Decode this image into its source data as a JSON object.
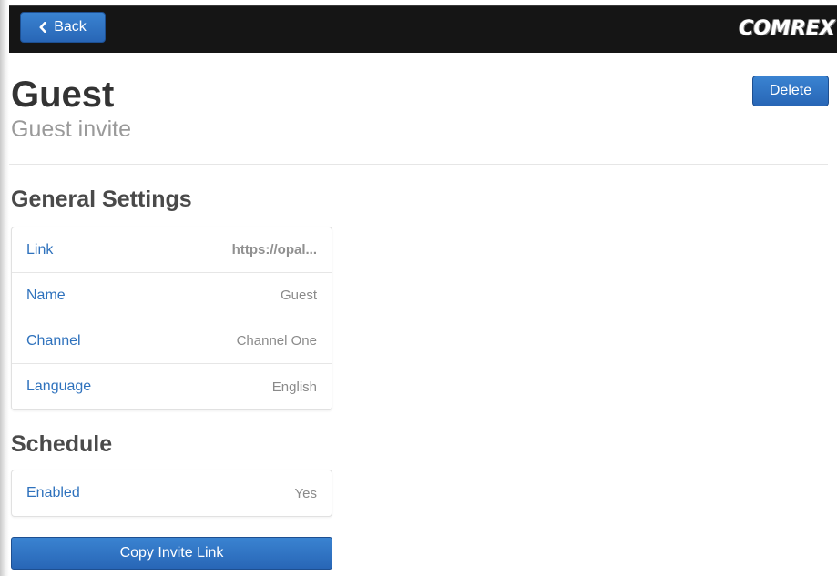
{
  "header": {
    "back_label": "Back",
    "logo_text": "COMREX"
  },
  "page": {
    "title": "Guest",
    "subtitle": "Guest invite",
    "delete_label": "Delete"
  },
  "general_settings": {
    "heading": "General Settings",
    "rows": [
      {
        "label": "Link",
        "value": "https://opal..."
      },
      {
        "label": "Name",
        "value": "Guest"
      },
      {
        "label": "Channel",
        "value": "Channel One"
      },
      {
        "label": "Language",
        "value": "English"
      }
    ]
  },
  "schedule": {
    "heading": "Schedule",
    "rows": [
      {
        "label": "Enabled",
        "value": "Yes"
      }
    ]
  },
  "actions": {
    "copy_invite_label": "Copy Invite Link"
  },
  "colors": {
    "accent": "#2866b6",
    "topbar": "#151515",
    "link_text": "#2f72bd"
  },
  "icons": {
    "back": "chevron-left-icon"
  }
}
